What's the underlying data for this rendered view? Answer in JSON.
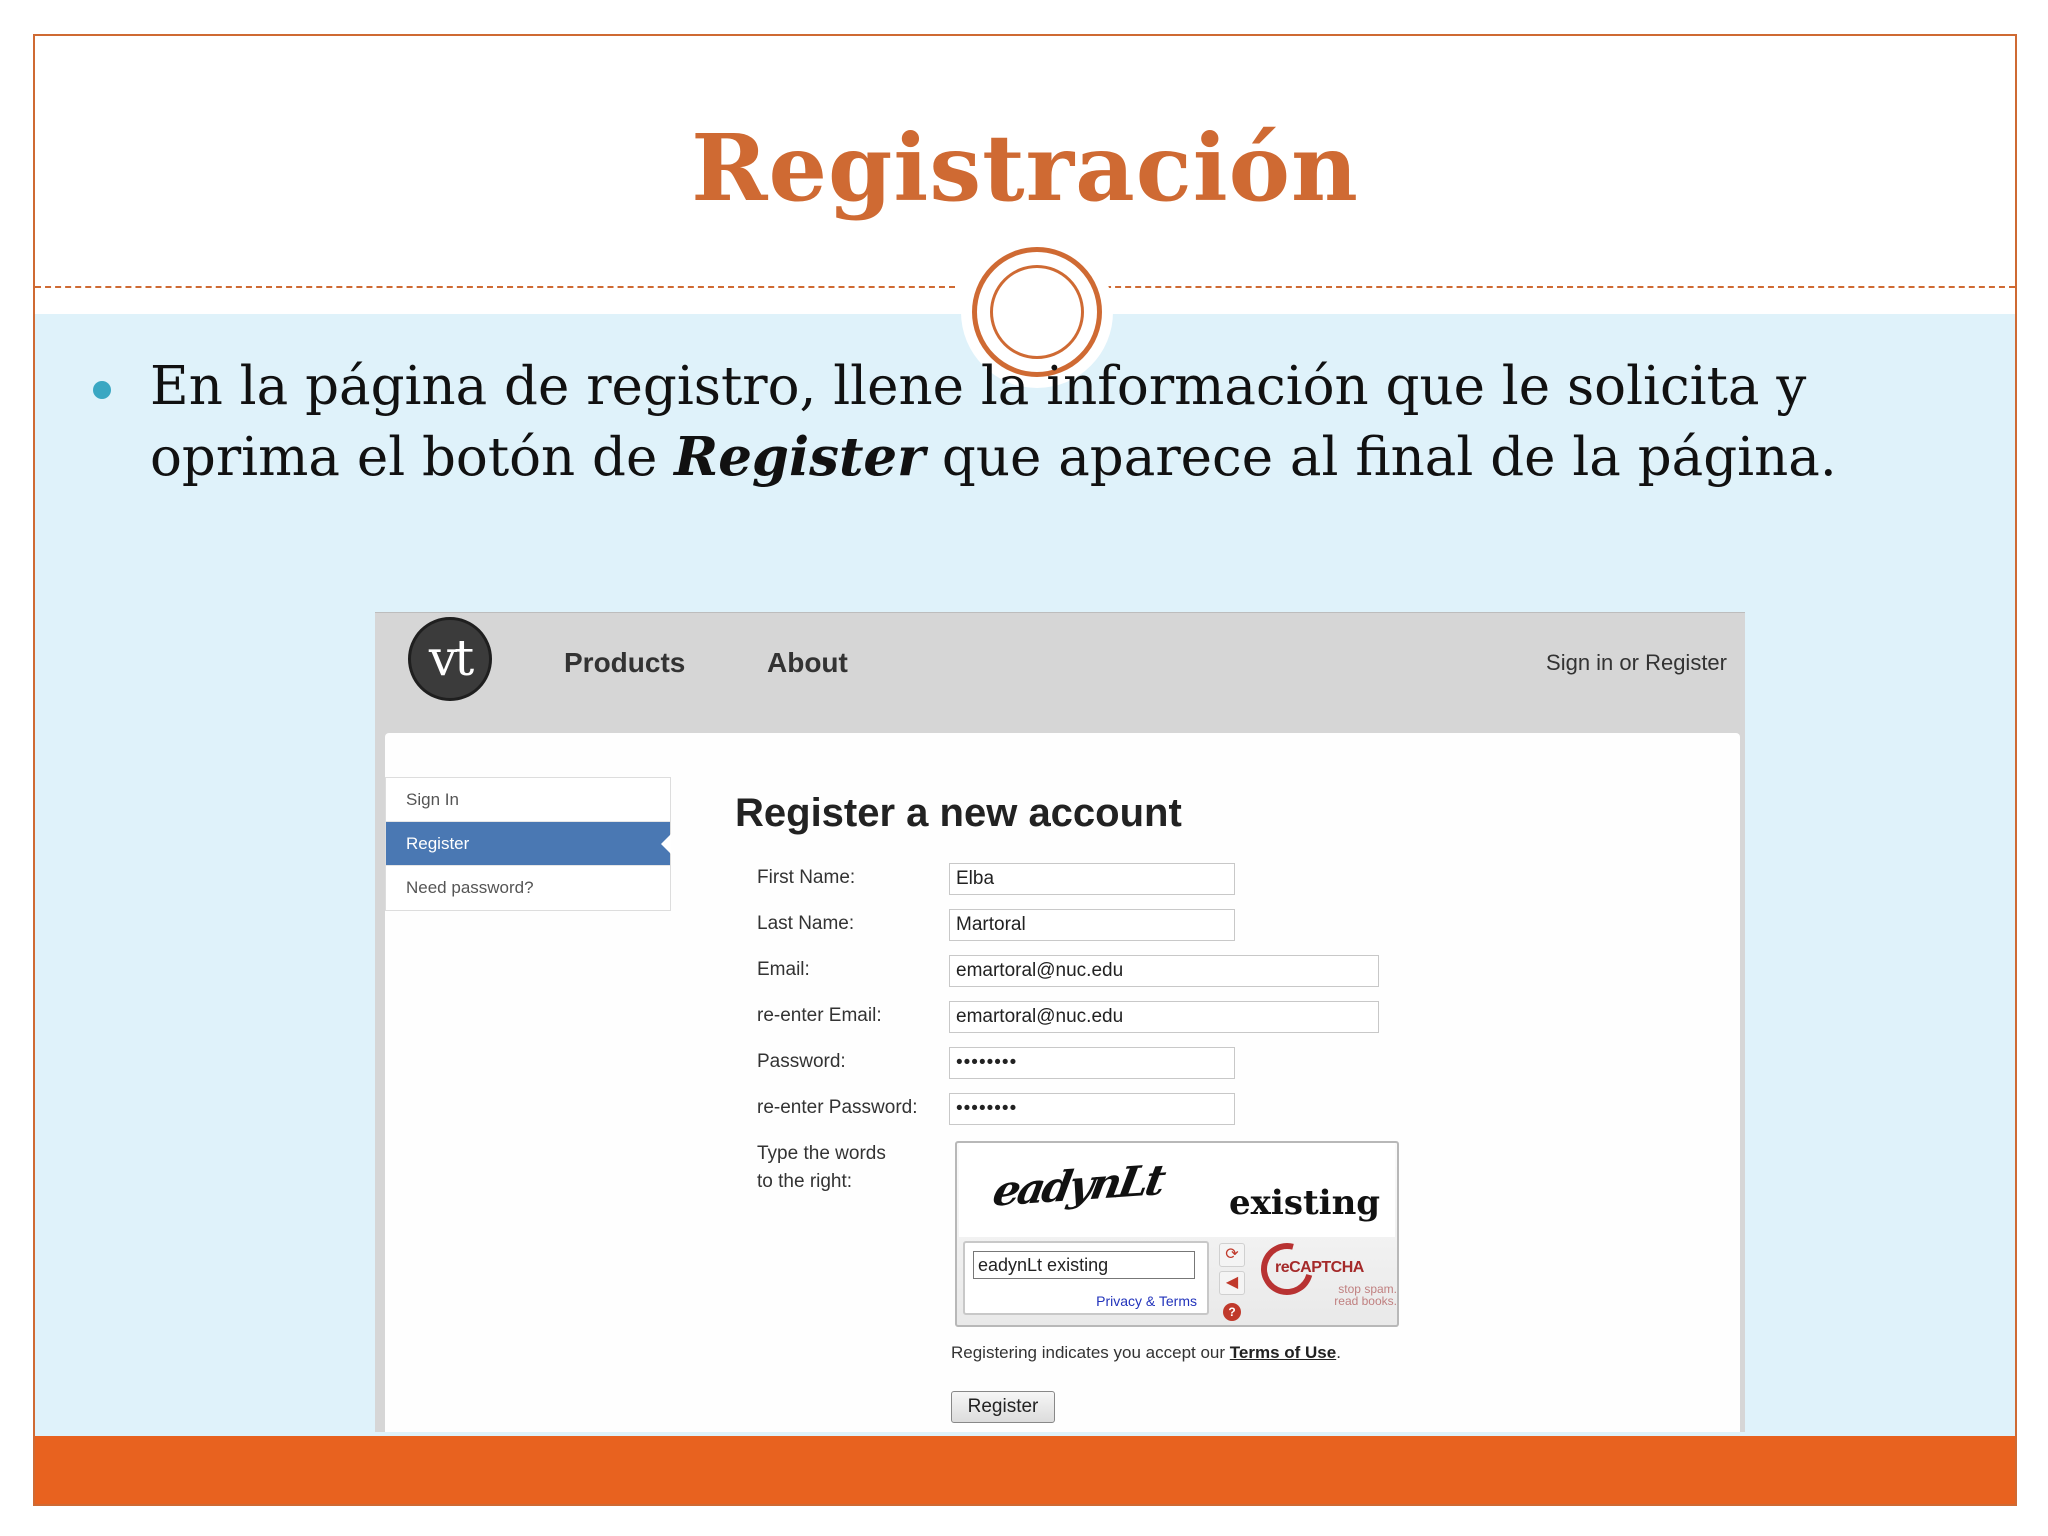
{
  "slide": {
    "title": "Registración",
    "bullet_part1": "En la página de registro, llene la información que le solicita y oprima el botón de ",
    "bullet_emphasis": "Register",
    "bullet_part2": " que aparece al final de la página."
  },
  "colors": {
    "title": "#cf6a33",
    "content_background": "#dff2fa",
    "footer_bar": "#e8621f",
    "bullet": "#3aa7c2",
    "active_menu": "#4a78b3"
  },
  "site": {
    "logo_text": "vt",
    "nav": [
      "Products",
      "About"
    ],
    "signin": "Sign in or Register"
  },
  "sidebar": {
    "items": [
      "Sign In",
      "Register",
      "Need password?"
    ],
    "active": "Register"
  },
  "form": {
    "title": "Register a new account",
    "fields": [
      {
        "label": "First Name:",
        "value": "Elba"
      },
      {
        "label": "Last Name:",
        "value": "Martoral"
      },
      {
        "label": "Email:",
        "value": "emartoral@nuc.edu"
      },
      {
        "label": "re-enter Email:",
        "value": "emartoral@nuc.edu"
      },
      {
        "label": "Password:",
        "value": "••••••••"
      },
      {
        "label": "re-enter Password:",
        "value": "••••••••"
      }
    ],
    "captcha_label_1": "Type the words",
    "captcha_label_2": "to the right:",
    "captcha_word_1": "eadynLt",
    "captcha_word_2": "existing",
    "captcha_input": "eadynLt existing",
    "captcha_privacy": "Privacy & Terms",
    "recaptcha_name": "reCAPTCHA",
    "recaptcha_tagline_1": "stop spam.",
    "recaptcha_tagline_2": "read books.",
    "terms_text": "Registering indicates you accept our ",
    "terms_link": "Terms of Use",
    "terms_end": ".",
    "register_button": "Register"
  }
}
